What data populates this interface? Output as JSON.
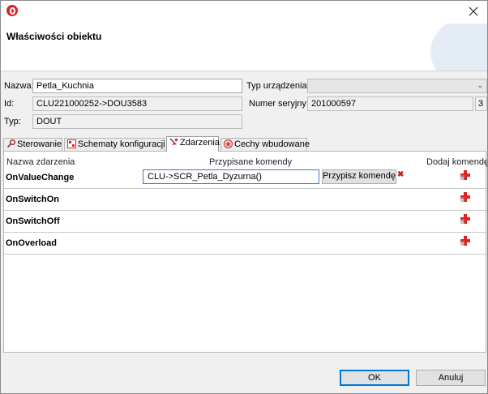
{
  "header": {
    "title": "Właściwości obiektu"
  },
  "form": {
    "name_label": "Nazwa:",
    "name_value": "Petla_Kuchnia",
    "id_label": "Id:",
    "id_value": "CLU221000252->DOU3583",
    "type_label": "Typ:",
    "type_value": "DOUT",
    "device_type_label": "Typ urządzenia:",
    "device_type_value": "",
    "serial_label": "Numer seryjny:",
    "serial_value": "201000597",
    "serial_extra": "3"
  },
  "tabs": [
    {
      "label": "Sterowanie",
      "icon": "wrench-icon"
    },
    {
      "label": "Schematy konfiguracji",
      "icon": "schema-icon"
    },
    {
      "label": "Zdarzenia",
      "icon": "events-icon",
      "active": true
    },
    {
      "label": "Cechy wbudowane",
      "icon": "star-badge-icon"
    }
  ],
  "events_table": {
    "col_event": "Nazwa zdarzenia",
    "col_commands": "Przypisane komendy",
    "col_add": "Dodaj komendę",
    "rows": [
      {
        "name": "OnValueChange",
        "command": "CLU->SCR_Petla_Dyzurna()",
        "assign_label": "Przypisz komendę"
      },
      {
        "name": "OnSwitchOn"
      },
      {
        "name": "OnSwitchOff"
      },
      {
        "name": "OnOverload"
      }
    ]
  },
  "footer": {
    "ok_label": "OK",
    "cancel_label": "Anuluj"
  },
  "colors": {
    "accent": "#0078d7",
    "brand": "#d7262c",
    "delete": "#c4211e"
  }
}
